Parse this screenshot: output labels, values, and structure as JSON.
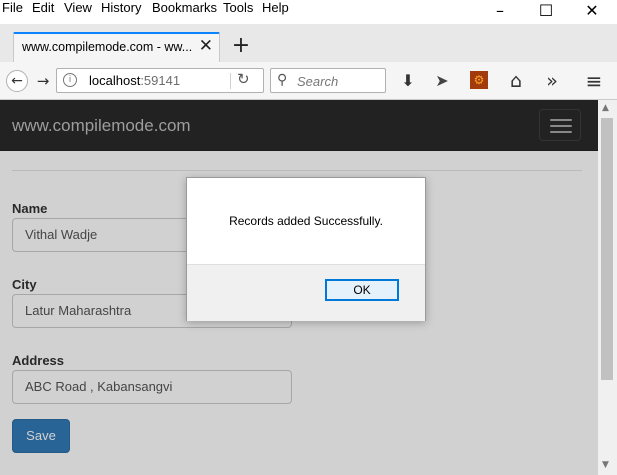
{
  "menu": [
    "File",
    "Edit",
    "View",
    "History",
    "Bookmarks",
    "Tools",
    "Help"
  ],
  "window": {
    "minimize": "–",
    "maximize": "☐",
    "close": "✕"
  },
  "tab": {
    "title": "www.compilemode.com - ww...",
    "close": "✕"
  },
  "new_tab": "+",
  "nav": {
    "back": "←",
    "forward": "→",
    "url_host": "localhost",
    "url_port": ":59141",
    "info": "i",
    "reload": "↻",
    "search_placeholder": "Search",
    "search_icon": "⚲",
    "download": "⬇",
    "send": "➤",
    "addon": "⚙",
    "home": "⌂",
    "overflow": "»",
    "menu": "≡"
  },
  "site": {
    "brand": "www.compilemode.com",
    "form": {
      "name_label": "Name",
      "name_value": "Vithal Wadje",
      "city_label": "City",
      "city_value": "Latur Maharashtra",
      "address_label": "Address",
      "address_value": "ABC Road , Kabansangvi",
      "save_label": "Save"
    }
  },
  "dialog": {
    "message": "Records added Successfully.",
    "ok_label": "OK"
  },
  "colors": {
    "navbar_bg": "#222222",
    "brand_text": "#9d9d9d",
    "primary_button": "#337ab7",
    "dialog_focus": "#0078d7"
  }
}
